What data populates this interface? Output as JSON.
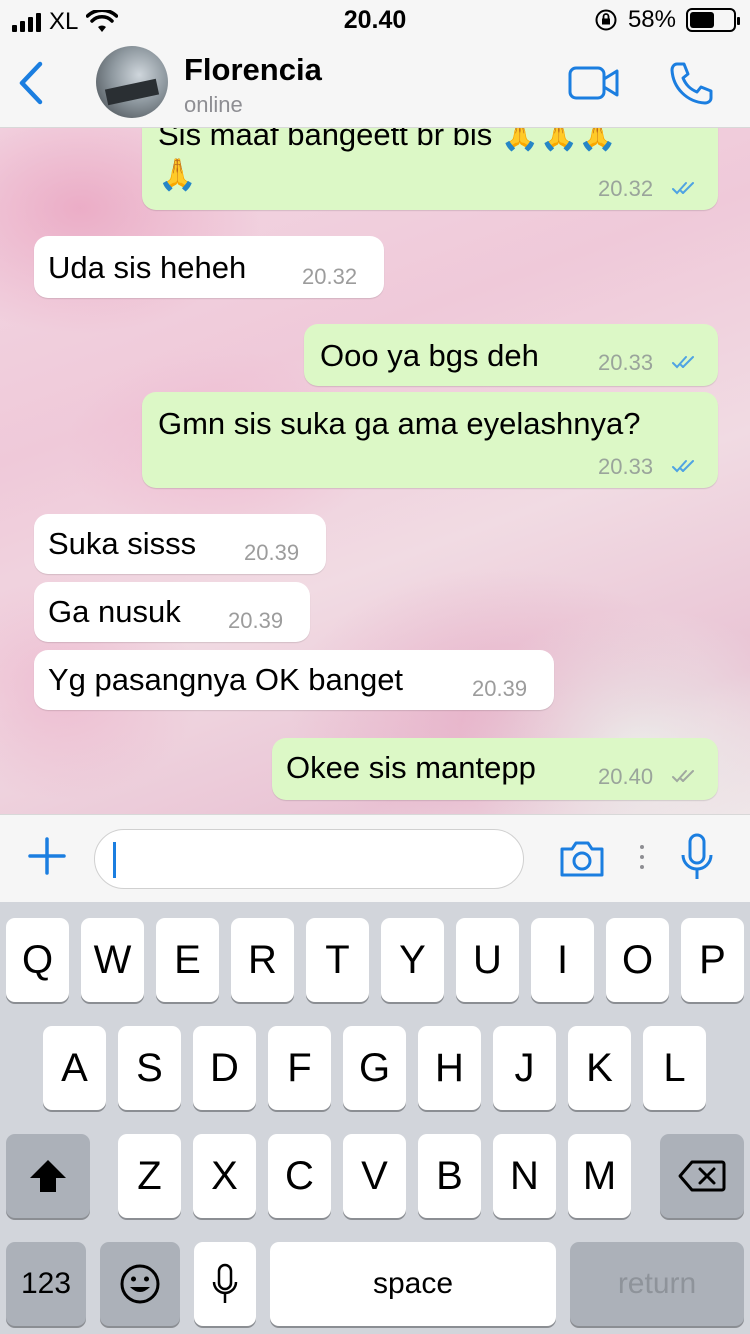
{
  "status_bar": {
    "carrier": "XL",
    "time": "20.40",
    "battery_percent": "58%",
    "battery_level": 0.58,
    "icons": [
      "signal-icon",
      "wifi-icon",
      "rotation-lock-icon",
      "battery-icon"
    ]
  },
  "header": {
    "contact_name": "Florencia",
    "contact_status": "online",
    "icons": [
      "back-chevron-icon",
      "avatar",
      "video-call-icon",
      "phone-call-icon"
    ]
  },
  "messages": [
    {
      "direction": "out",
      "text": "Sis maaf bangeett br bis 🙏🙏🙏",
      "text2": "🙏",
      "time": "20.32",
      "read": true
    },
    {
      "direction": "in",
      "text": "Uda sis heheh",
      "time": "20.32"
    },
    {
      "direction": "out",
      "text": "Ooo ya bgs deh",
      "time": "20.33",
      "read": true
    },
    {
      "direction": "out",
      "text": "Gmn sis suka ga ama eyelashnya?",
      "time": "20.33",
      "read": true
    },
    {
      "direction": "in",
      "text": "Suka sisss",
      "time": "20.39"
    },
    {
      "direction": "in",
      "text": "Ga nusuk",
      "time": "20.39"
    },
    {
      "direction": "in",
      "text": "Yg pasangnya OK banget",
      "time": "20.39"
    },
    {
      "direction": "out",
      "text": "Okee sis mantepp",
      "time": "20.40",
      "read": false
    }
  ],
  "input_bar": {
    "value": "",
    "icons": [
      "plus-icon",
      "camera-icon",
      "more-dots-icon",
      "microphone-icon"
    ]
  },
  "keyboard": {
    "row1": [
      "Q",
      "W",
      "E",
      "R",
      "T",
      "Y",
      "U",
      "I",
      "O",
      "P"
    ],
    "row2": [
      "A",
      "S",
      "D",
      "F",
      "G",
      "H",
      "J",
      "K",
      "L"
    ],
    "row3": [
      "Z",
      "X",
      "C",
      "V",
      "B",
      "N",
      "M"
    ],
    "numbers_label": "123",
    "space_label": "space",
    "return_label": "return",
    "icons": [
      "shift-icon",
      "backspace-icon",
      "emoji-icon",
      "dictation-mic-icon"
    ]
  },
  "colors": {
    "accent": "#1b7ee0",
    "outgoing_bubble": "#dcf8c6",
    "incoming_bubble": "#ffffff",
    "read_ticks": "#4fa3e3",
    "unread_ticks": "#a0a8a0"
  }
}
